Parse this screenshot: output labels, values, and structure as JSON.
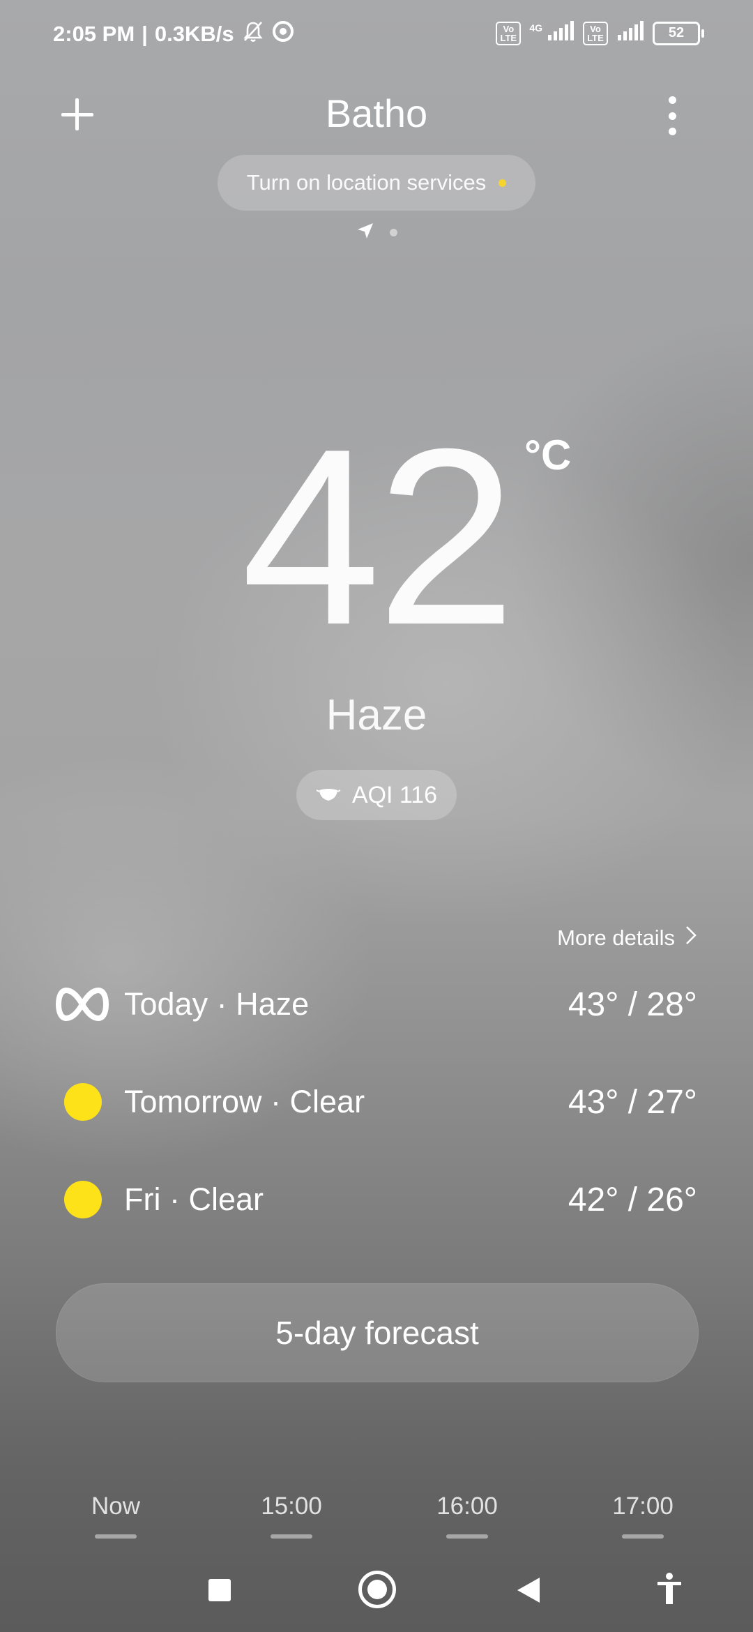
{
  "status_bar": {
    "time": "2:05 PM",
    "separator": "|",
    "network_speed": "0.3KB/s",
    "volte_1": "Vo LTE",
    "network_type": "4G",
    "volte_2": "Vo LTE",
    "battery": "52",
    "icons": [
      "mute-bell-icon",
      "chrome-icon",
      "signal-icon",
      "battery-icon"
    ]
  },
  "header": {
    "city": "Batho",
    "location_prompt": "Turn on location services",
    "location_dot_color": "#f5d431"
  },
  "current": {
    "temperature": "42",
    "unit": "°C",
    "condition": "Haze",
    "aqi_label": "AQI 116"
  },
  "forecast": {
    "more_details_label": "More details",
    "rows": [
      {
        "label": "Today · Haze",
        "temps": "43° / 28°",
        "icon": "haze-icon"
      },
      {
        "label": "Tomorrow · Clear",
        "temps": "43° / 27°",
        "icon": "sun-icon"
      },
      {
        "label": "Fri · Clear",
        "temps": "42° / 26°",
        "icon": "sun-icon"
      }
    ],
    "sun_color": "#fde21a",
    "five_day_label": "5-day forecast"
  },
  "hourly": {
    "times": [
      "Now",
      "15:00",
      "16:00",
      "17:00"
    ]
  }
}
